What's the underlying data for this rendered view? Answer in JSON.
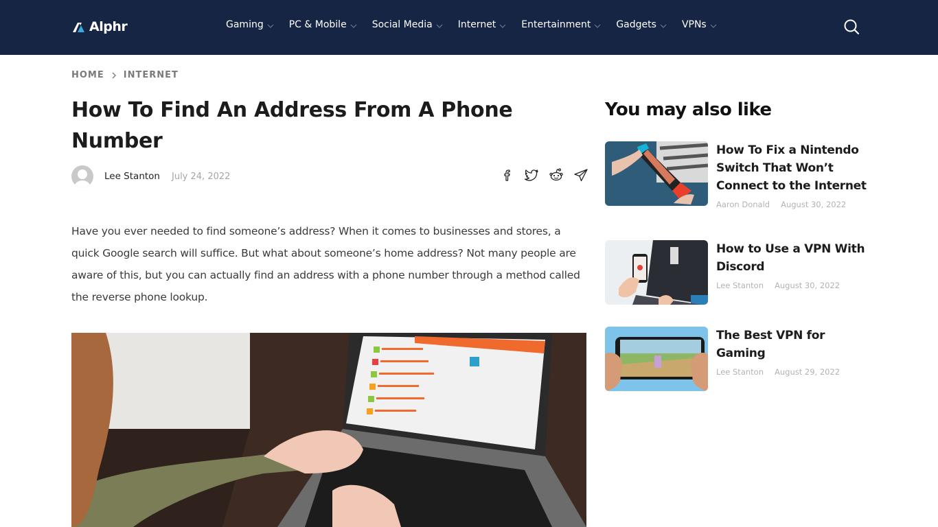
{
  "nav": {
    "logo_text": "Alphr",
    "items": [
      {
        "label": "Gaming"
      },
      {
        "label": "PC & Mobile"
      },
      {
        "label": "Social Media"
      },
      {
        "label": "Internet"
      },
      {
        "label": "Entertainment"
      },
      {
        "label": "Gadgets"
      },
      {
        "label": "VPNs"
      }
    ],
    "search_icon": "search-icon"
  },
  "breadcrumb": {
    "home": "HOME",
    "current": "INTERNET"
  },
  "article": {
    "title": "How To Find An Address From A Phone Number",
    "author": "Lee Stanton",
    "date": "July 24, 2022",
    "share_icons": [
      "facebook-icon",
      "twitter-icon",
      "reddit-icon",
      "telegram-icon"
    ],
    "intro": "Have you ever needed to find someone’s address? When it comes to businesses and stores, a quick Google search will suffice. But what about someone’s home address? Not many people are aware of this, but you can actually find an address with a phone number through a method called the reverse phone lookup.",
    "hero_image": "woman typing on laptop showing reverse phone lookup site"
  },
  "sidebar": {
    "title": "You may also like",
    "accent_color": "#4a80c4",
    "items": [
      {
        "title": "How To Fix a Nintendo Switch That Won’t Connect to the Internet",
        "author": "Aaron Donald",
        "date": "August 30, 2022",
        "thumb": "nintendo switch in hands"
      },
      {
        "title": "How to Use a VPN With Discord",
        "author": "Lee Stanton",
        "date": "August 30, 2022",
        "thumb": "phone and laptop with discord"
      },
      {
        "title": "The Best VPN for Gaming",
        "author": "Lee Stanton",
        "date": "August 29, 2022",
        "thumb": "mobile game on phone in hands"
      }
    ]
  },
  "colors": {
    "nav_bg": "#162544",
    "text_dark": "#1c1c1c",
    "meta_gray": "#a5a5a5"
  }
}
